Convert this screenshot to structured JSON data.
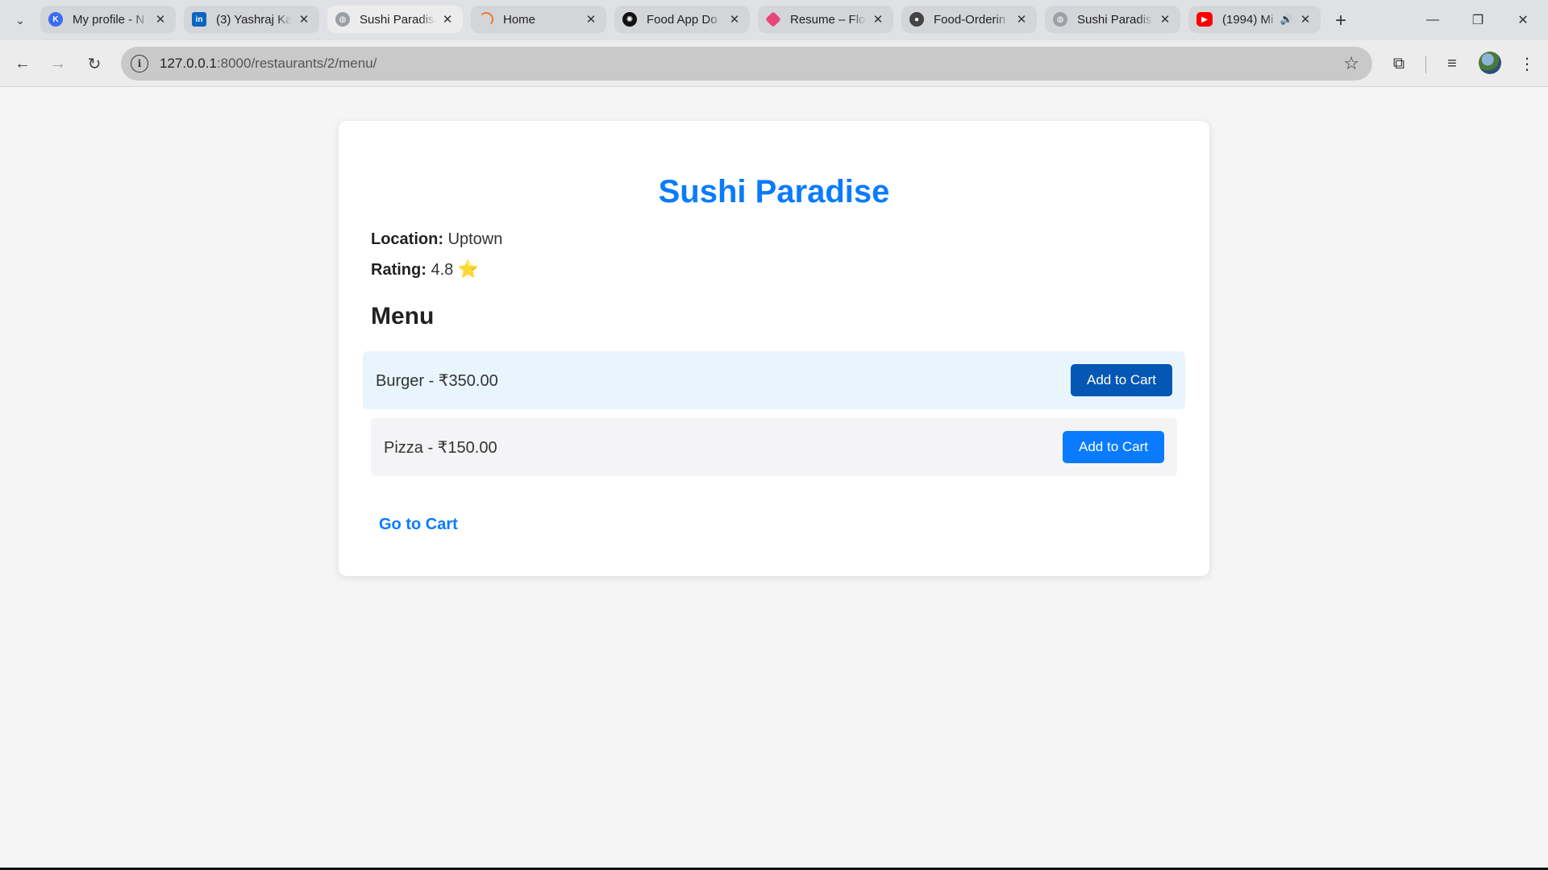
{
  "browser": {
    "tabs": [
      {
        "title": "My profile - N",
        "favicon": "k-favicon",
        "color": "#3a6cf4",
        "glyph": "K"
      },
      {
        "title": "(3) Yashraj Ka",
        "favicon": "linkedin-favicon",
        "color": "#0a66c2",
        "glyph": "in"
      },
      {
        "title": "Sushi Paradise",
        "favicon": "globe-favicon",
        "color": "#9aa0a6",
        "glyph": ""
      },
      {
        "title": "Home",
        "favicon": "spinner-favicon",
        "color": "#f07a2a",
        "glyph": ""
      },
      {
        "title": "Food App Do",
        "favicon": "openai-favicon",
        "color": "#111111",
        "glyph": "✺"
      },
      {
        "title": "Resume – Flo",
        "favicon": "flowcv-favicon",
        "color": "#e8457a",
        "glyph": ""
      },
      {
        "title": "Food-Orderin",
        "favicon": "github-favicon",
        "color": "#444444",
        "glyph": ""
      },
      {
        "title": "Sushi Paradise",
        "favicon": "globe-favicon",
        "color": "#9aa0a6",
        "glyph": ""
      },
      {
        "title": "(1994) Mi",
        "favicon": "youtube-favicon",
        "color": "#ff0000",
        "glyph": "▶"
      }
    ],
    "address": {
      "host": "127.0.0.1",
      "path": ":8000/restaurants/2/menu/"
    }
  },
  "restaurant": {
    "name": "Sushi Paradise",
    "location_label": "Location:",
    "location": "Uptown",
    "rating_label": "Rating:",
    "rating": "4.8",
    "rating_icon": "⭐"
  },
  "menu": {
    "heading": "Menu",
    "items": [
      {
        "label": "Burger - ₹350.00",
        "button": "Add to Cart"
      },
      {
        "label": "Pizza - ₹150.00",
        "button": "Add to Cart"
      }
    ]
  },
  "footer": {
    "go_to_cart": "Go to Cart"
  },
  "colors": {
    "accent": "#0a7bff",
    "button_hover": "#0557b5",
    "row_highlight": "#e8f5fd",
    "row_default": "#f4f4f6"
  }
}
